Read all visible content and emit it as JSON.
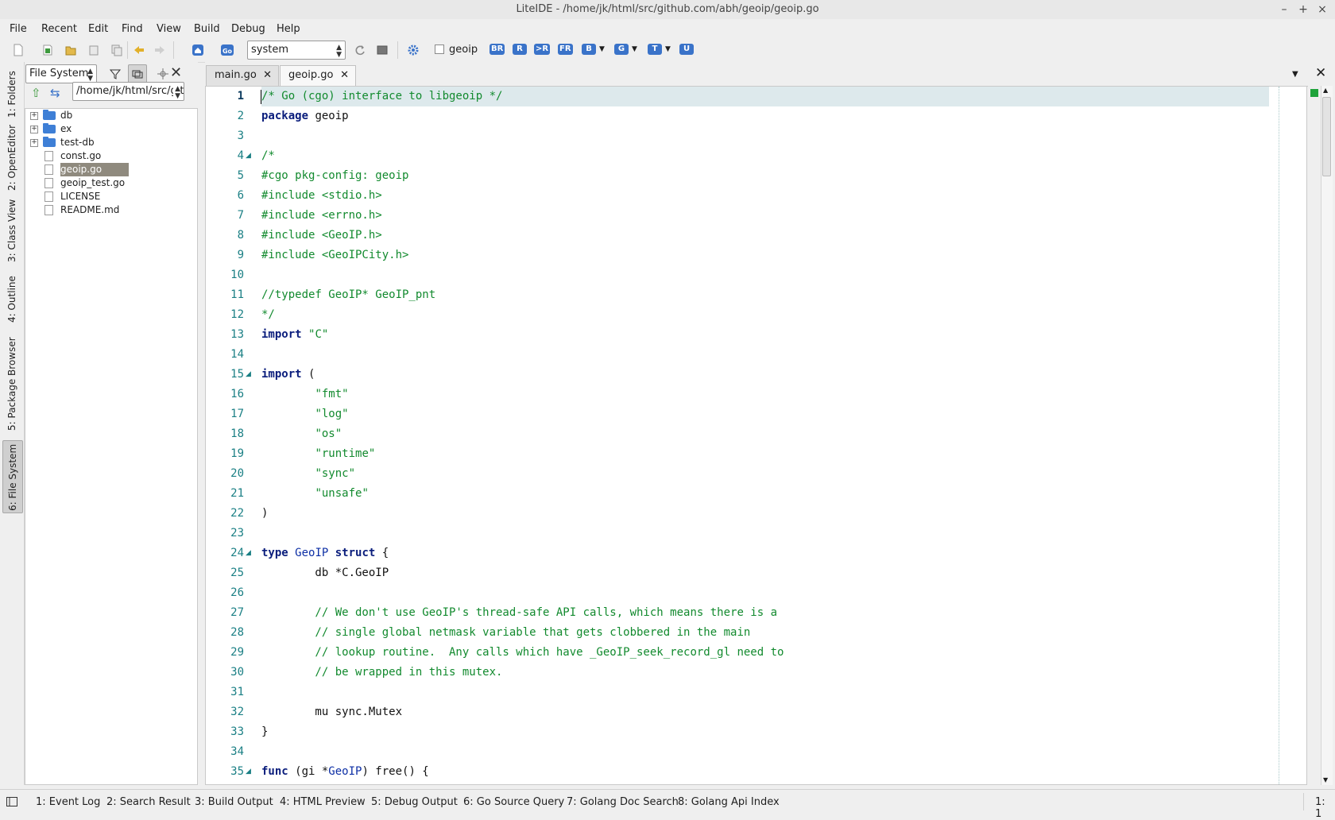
{
  "window": {
    "title": "LiteIDE - /home/jk/html/src/github.com/abh/geoip/geoip.go",
    "controls": [
      "–",
      "+",
      "×"
    ]
  },
  "menu": [
    "File",
    "Recent",
    "Edit",
    "Find",
    "View",
    "Build",
    "Debug",
    "Help"
  ],
  "toolbar": {
    "env_select": "system",
    "build_target_label": "geoip",
    "build_buttons": [
      "BR",
      "R",
      ">R",
      "FR",
      "B",
      "G",
      "T",
      "U"
    ]
  },
  "left_tabs": [
    "1: Folders",
    "2: OpenEditor",
    "3: Class View",
    "4: Outline",
    "5: Package Browser",
    "6: File System"
  ],
  "file_panel": {
    "view_select": "File System",
    "path": "/home/jk/html/src/gitl",
    "items": [
      {
        "name": "db",
        "type": "folder"
      },
      {
        "name": "ex",
        "type": "folder"
      },
      {
        "name": "test-db",
        "type": "folder"
      },
      {
        "name": "const.go",
        "type": "file"
      },
      {
        "name": "geoip.go",
        "type": "file",
        "selected": true
      },
      {
        "name": "geoip_test.go",
        "type": "file"
      },
      {
        "name": "LICENSE",
        "type": "file"
      },
      {
        "name": "README.md",
        "type": "file"
      }
    ]
  },
  "editor_tabs": [
    {
      "label": "main.go"
    },
    {
      "label": "geoip.go",
      "active": true
    }
  ],
  "code_lines": [
    "/* Go (cgo) interface to libgeoip */",
    "package geoip",
    "",
    "/*",
    "#cgo pkg-config: geoip",
    "#include <stdio.h>",
    "#include <errno.h>",
    "#include <GeoIP.h>",
    "#include <GeoIPCity.h>",
    "",
    "//typedef GeoIP* GeoIP_pnt",
    "*/",
    "import \"C\"",
    "",
    "import (",
    "        \"fmt\"",
    "        \"log\"",
    "        \"os\"",
    "        \"runtime\"",
    "        \"sync\"",
    "        \"unsafe\"",
    ")",
    "",
    "type GeoIP struct {",
    "        db *C.GeoIP",
    "",
    "        // We don't use GeoIP's thread-safe API calls, which means there is a",
    "        // single global netmask variable that gets clobbered in the main",
    "        // lookup routine.  Any calls which have _GeoIP_seek_record_gl need to",
    "        // be wrapped in this mutex.",
    "",
    "        mu sync.Mutex",
    "}",
    "",
    "func (gi *GeoIP) free() {"
  ],
  "bottom_tabs": [
    "1: Event Log",
    "2: Search Result",
    "3: Build Output",
    "4: HTML Preview",
    "5: Debug Output",
    "6: Go Source Query",
    "7: Golang Doc Search",
    "8: Golang Api Index"
  ],
  "status": {
    "cursor": "1: 1"
  }
}
